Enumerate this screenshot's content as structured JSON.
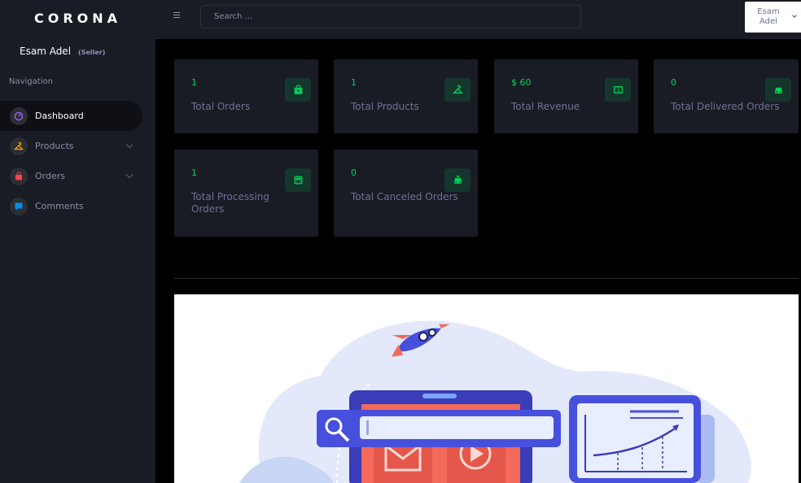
{
  "brand": {
    "name": "CORONA"
  },
  "profile": {
    "name": "Esam Adel",
    "role": "(Seller)"
  },
  "navigation": {
    "category": "Navigation",
    "items": [
      {
        "label": "Dashboard",
        "icon": "speedometer-icon",
        "color": "#8f5fe8",
        "active": true
      },
      {
        "label": "Products",
        "icon": "hanger-icon",
        "color": "#ffab00",
        "has_submenu": true
      },
      {
        "label": "Orders",
        "icon": "bag-icon",
        "color": "#fc424a",
        "has_submenu": true
      },
      {
        "label": "Comments",
        "icon": "chat-icon",
        "color": "#0090e7"
      }
    ]
  },
  "topbar": {
    "search_placeholder": "Search ...",
    "user_line1": "Esam",
    "user_line2": "Adel"
  },
  "stats": [
    {
      "value": "1",
      "label": "Total Orders",
      "icon": "shopping-bag-icon"
    },
    {
      "value": "1",
      "label": "Total Products",
      "icon": "hanger-icon"
    },
    {
      "value": "$ 60",
      "label": "Total Revenue",
      "icon": "cash-icon"
    },
    {
      "value": "0",
      "label": "Total Delivered Orders",
      "icon": "car-icon"
    },
    {
      "value": "1",
      "label": "Total Processing Orders",
      "icon": "bus-icon"
    },
    {
      "value": "0",
      "label": "Total Canceled Orders",
      "icon": "taxi-icon"
    }
  ],
  "colors": {
    "accent_success": "#00d25b",
    "sidebar_bg": "#191c24",
    "page_bg": "#000000"
  }
}
